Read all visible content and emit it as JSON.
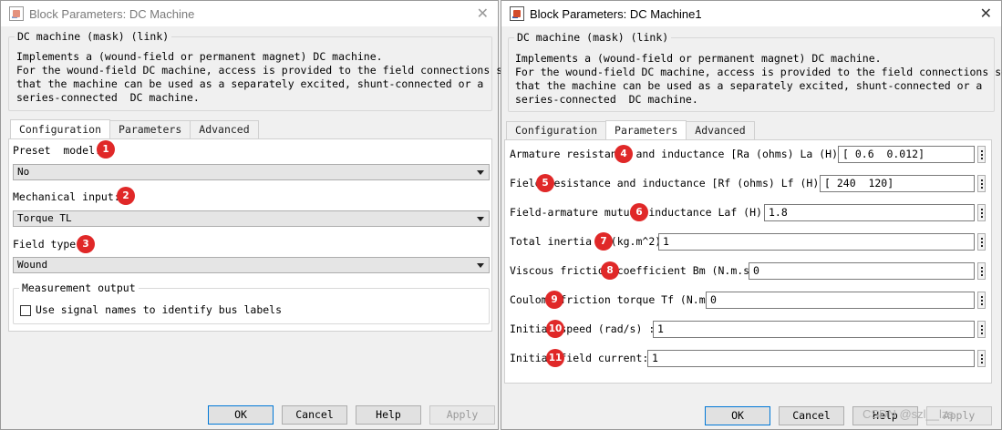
{
  "left": {
    "window_title": "Block Parameters: DC Machine",
    "group_title": "DC machine (mask) (link)",
    "description": "Implements a (wound-field or permanent magnet) DC machine.\nFor the wound-field DC machine, access is provided to the field connections so\nthat the machine can be used as a separately excited, shunt-connected or a\nseries-connected  DC machine.",
    "tabs": [
      "Configuration",
      "Parameters",
      "Advanced"
    ],
    "active_tab": "Configuration",
    "preset_label": "Preset  model:",
    "preset_value": "No",
    "mech_label": "Mechanical input:",
    "mech_value": "Torque TL",
    "field_label": "Field type:",
    "field_value": "Wound",
    "measurement_title": "Measurement output",
    "bus_labels_checkbox": "Use signal names to identify bus labels",
    "bus_labels_checked": false,
    "buttons": {
      "ok": "OK",
      "cancel": "Cancel",
      "help": "Help",
      "apply": "Apply"
    }
  },
  "right": {
    "window_title": "Block Parameters: DC Machine1",
    "group_title": "DC machine (mask) (link)",
    "description": "Implements a (wound-field or permanent magnet) DC machine.\nFor the wound-field DC machine, access is provided to the field connections so\nthat the machine can be used as a separately excited, shunt-connected or a\nseries-connected  DC machine.",
    "tabs": [
      "Configuration",
      "Parameters",
      "Advanced"
    ],
    "active_tab": "Parameters",
    "params": [
      {
        "label": "Armature resistance and inductance [Ra (ohms) La (H) ]",
        "value": "[ 0.6  0.012]"
      },
      {
        "label": "Field resistance and inductance [Rf (ohms) Lf (H) ]",
        "value": "[ 240  120]"
      },
      {
        "label": "Field-armature mutual inductance Laf (H) :",
        "value": "1.8"
      },
      {
        "label": "Total inertia J (kg.m^2)",
        "value": "1"
      },
      {
        "label": "Viscous friction coefficient Bm (N.m.s)",
        "value": "0"
      },
      {
        "label": "Coulomb friction torque Tf (N.m)",
        "value": "0"
      },
      {
        "label": "Initial speed (rad/s) :",
        "value": "1"
      },
      {
        "label": "Initial field current:",
        "value": "1"
      }
    ],
    "buttons": {
      "ok": "OK",
      "cancel": "Cancel",
      "help": "Help",
      "apply": "Apply"
    }
  },
  "annotations": [
    "1",
    "2",
    "3",
    "4",
    "5",
    "6",
    "7",
    "8",
    "9",
    "10",
    "11"
  ],
  "watermark": "CSDN @szl__lzs"
}
